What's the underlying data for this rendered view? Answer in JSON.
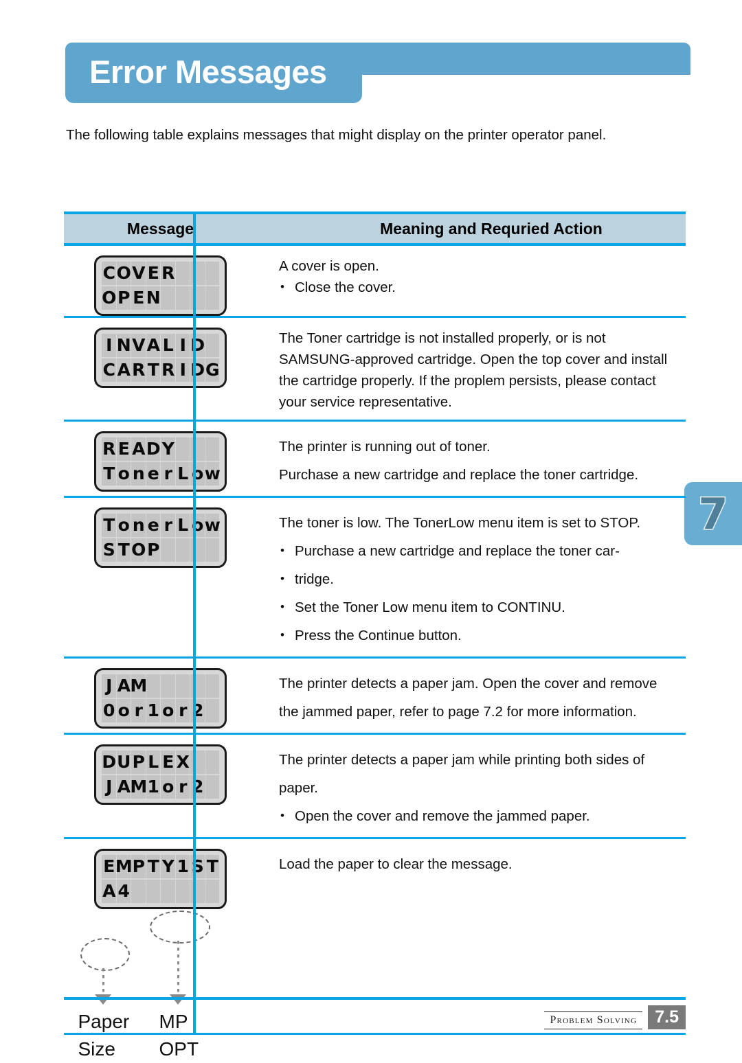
{
  "page": {
    "title": "Error Messages",
    "intro": "The following table explains messages that might display on the printer operator panel.",
    "side_tab_number": "7",
    "accent_color": "#0aa5e4",
    "banner_color": "#5fa5ce",
    "header_fill_color": "#bcd3df"
  },
  "table": {
    "columns": [
      "Message",
      "Meaning and Requried Action"
    ],
    "rows": [
      {
        "lcd": {
          "line1": "COVER",
          "line2": "OPEN",
          "cells": 8
        },
        "intro_text": "A cover is open.",
        "bullets": [
          "Close the cover."
        ],
        "paragraphs": []
      },
      {
        "lcd": {
          "line1": "INVALID",
          "line2": "CARTRIDG",
          "cells": 8
        },
        "intro_text": "",
        "bullets": [],
        "paragraphs": [
          "The Toner cartridge is not installed properly, or is not SAMSUNG-approved cartridge. Open the top cover and install the cartridge properly. If the proplem persists, please contact your service representative."
        ]
      },
      {
        "lcd": {
          "line1": "READY",
          "line2": "TonerLow",
          "cells": 8
        },
        "intro_text": "",
        "bullets": [],
        "paragraphs": [
          "The printer is running out of toner.",
          "Purchase a new cartridge and replace the toner cartridge."
        ]
      },
      {
        "lcd": {
          "line1": "TonerLow",
          "line2": "STOP",
          "cells": 8
        },
        "intro_text": "The toner is low. The TonerLow menu item is set to STOP.",
        "bullets": [
          "Purchase a new cartridge and replace the toner car-",
          "Set the Toner Low menu item to CONTINU.",
          "Press the Continue button."
        ],
        "bullet_continuation": "tridge.",
        "paragraphs": []
      },
      {
        "lcd": {
          "line1": "JAM",
          "line2": "0or1or2",
          "cells": 8
        },
        "intro_text": "",
        "bullets": [],
        "paragraphs": [
          "The printer detects a paper jam. Open the cover and remove the jammed paper, refer to page 7.2 for more information."
        ]
      },
      {
        "lcd": {
          "line1": "DUPLEX",
          "line2": "JAM1or2",
          "cells": 8
        },
        "intro_text": "The printer detects a paper jam while printing both sides of paper.",
        "bullets": [
          "Open the cover and remove the jammed paper."
        ],
        "paragraphs": []
      },
      {
        "lcd": {
          "line1": "EMPTY1ST",
          "line2": "A4",
          "cells": 8
        },
        "intro_text": "",
        "bullets": [],
        "paragraphs": [
          "Load the paper to clear the message."
        ],
        "annotation": {
          "label_left_line1": "Paper",
          "label_left_line2": "Size",
          "label_right_line1": "MP",
          "label_right_line2": "OPT"
        }
      }
    ]
  },
  "footer": {
    "chapter": "Problem Solving",
    "page_number": "7.5"
  }
}
